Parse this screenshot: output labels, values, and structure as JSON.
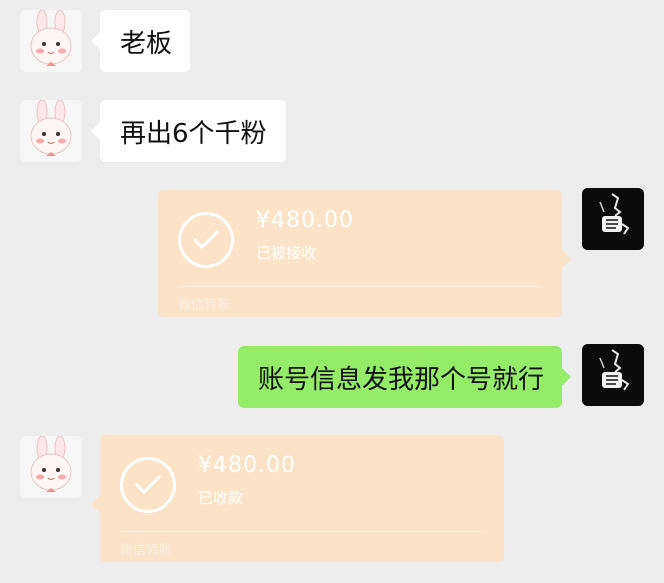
{
  "messages": [
    {
      "side": "left",
      "text": "老板"
    },
    {
      "side": "left",
      "text": "再出6个千粉"
    },
    {
      "side": "right",
      "type": "transfer",
      "amount": "¥480.00",
      "status": "已被接收",
      "footer": "微信转账"
    },
    {
      "side": "right",
      "text": "账号信息发我那个号就行"
    },
    {
      "side": "left",
      "type": "transfer",
      "amount": "¥480.00",
      "status": "已收款",
      "footer": "微信转账"
    }
  ],
  "icons": {
    "check": "check-icon",
    "bunny_avatar": "bunny-avatar",
    "dark_avatar": "dark-avatar"
  },
  "colors": {
    "background": "#ededed",
    "bubble_white": "#ffffff",
    "bubble_green": "#95ec69",
    "transfer_bg": "#fbe3c7"
  }
}
